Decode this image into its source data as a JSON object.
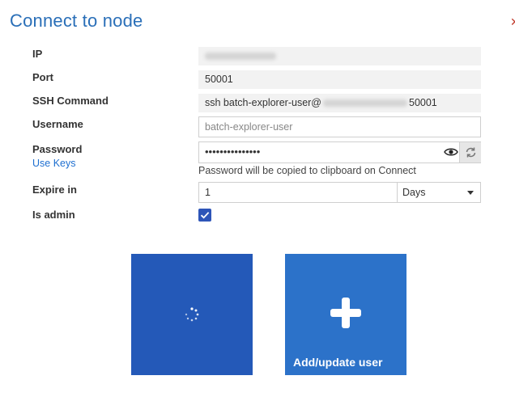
{
  "dialog": {
    "title": "Connect to node",
    "close_icon": "close-icon",
    "accent_color": "#2a6fb8"
  },
  "form": {
    "ip": {
      "label": "IP"
    },
    "port": {
      "label": "Port",
      "value": "50001"
    },
    "ssh_command": {
      "label": "SSH Command",
      "prefix": "ssh batch-explorer-user@",
      "suffix": "50001"
    },
    "username": {
      "label": "Username",
      "placeholder": "batch-explorer-user"
    },
    "password": {
      "label": "Password",
      "value": "•••••••••••••••",
      "use_keys_link": "Use Keys",
      "hint": "Password will be copied to clipboard on Connect",
      "show_icon": "eye-icon",
      "regenerate_icon": "refresh-icon"
    },
    "expire_in": {
      "label": "Expire in",
      "value": "1",
      "unit": "Days"
    },
    "is_admin": {
      "label": "Is admin",
      "checked": true
    }
  },
  "actions": {
    "connect_tile": {
      "state": "loading",
      "icon": "spinner-icon"
    },
    "add_user_tile": {
      "label": "Add/update user",
      "icon": "plus-icon"
    }
  }
}
